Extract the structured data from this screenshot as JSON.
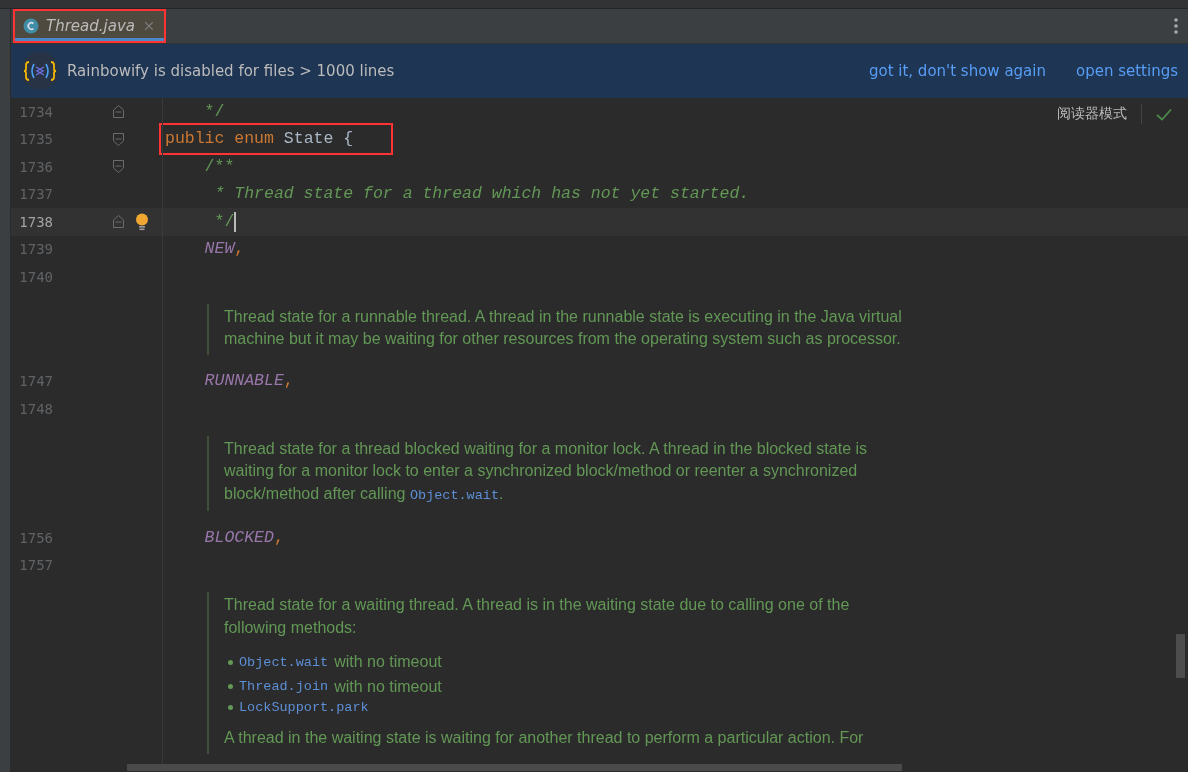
{
  "tabs": [
    {
      "label": "Thread.java",
      "selected": true,
      "highlighted": true
    }
  ],
  "banner": {
    "message": "Rainbowify is disabled for files > 1000 lines",
    "actions": [
      "got it, don't show again",
      "open settings"
    ]
  },
  "reader_mode": {
    "label": "阅读器模式"
  },
  "editor": {
    "lines": [
      {
        "kind": "code",
        "number": "1734",
        "current": false,
        "fold_close": true,
        "tokens": [
          {
            "text": "    */",
            "kind": "comment"
          }
        ]
      },
      {
        "kind": "code",
        "number": "1735",
        "current": false,
        "fold_open": true,
        "highlighted": true,
        "tokens": [
          {
            "text": "public ",
            "kind": "keyword"
          },
          {
            "text": "enum ",
            "kind": "keyword"
          },
          {
            "text": "State {",
            "kind": "plain"
          }
        ]
      },
      {
        "kind": "code",
        "number": "1736",
        "current": false,
        "fold_open": true,
        "tokens": [
          {
            "text": "    /**",
            "kind": "comment"
          }
        ]
      },
      {
        "kind": "code",
        "number": "1737",
        "current": false,
        "tokens": [
          {
            "text": "     * Thread state for a thread which has not yet started.",
            "kind": "doccomment"
          }
        ]
      },
      {
        "kind": "code",
        "number": "1738",
        "current": true,
        "fold_close": true,
        "bulb": true,
        "tokens": [
          {
            "text": "     */",
            "kind": "comment"
          }
        ]
      },
      {
        "kind": "code",
        "number": "1739",
        "current": false,
        "tokens": [
          {
            "text": "    NEW",
            "kind": "constant"
          },
          {
            "text": ",",
            "kind": "keyword"
          }
        ]
      },
      {
        "kind": "code",
        "number": "1740",
        "current": false
      },
      {
        "kind": "doc",
        "paragraphs": [
          [
            {
              "text": "Thread state for a runnable thread. A thread in the runnable state is executing in the Java virtual machine but it may be waiting for other resources from the operating system such as processor.",
              "kind": "text"
            }
          ]
        ]
      },
      {
        "kind": "code",
        "number": "1747",
        "current": false,
        "tokens": [
          {
            "text": "    RUNNABLE",
            "kind": "constant"
          },
          {
            "text": ",",
            "kind": "keyword"
          }
        ]
      },
      {
        "kind": "code",
        "number": "1748",
        "current": false
      },
      {
        "kind": "doc",
        "paragraphs": [
          [
            {
              "text": "Thread state for a thread blocked waiting for a monitor lock. A thread in the blocked state is waiting for a monitor lock to enter a synchronized block/method or reenter a synchronized block/method after calling ",
              "kind": "text"
            },
            {
              "text": "Object.wait",
              "kind": "code"
            },
            {
              "text": ".",
              "kind": "text"
            }
          ]
        ]
      },
      {
        "kind": "code",
        "number": "1756",
        "current": false,
        "tokens": [
          {
            "text": "    BLOCKED",
            "kind": "constant"
          },
          {
            "text": ",",
            "kind": "keyword"
          }
        ]
      },
      {
        "kind": "code",
        "number": "1757",
        "current": false
      },
      {
        "kind": "doc",
        "paragraphs": [
          [
            {
              "text": "Thread state for a waiting thread. A thread is in the waiting state due to calling one of the following methods:",
              "kind": "text"
            }
          ]
        ],
        "list": [
          {
            "code": "Object.wait",
            "text": "with no timeout"
          },
          {
            "code": "Thread.join",
            "text": "with no timeout"
          },
          {
            "code": "LockSupport.park"
          }
        ],
        "after": [
          [
            {
              "text": "A thread in the waiting state is waiting for another thread to perform a particular action. For",
              "kind": "text"
            }
          ]
        ]
      }
    ]
  }
}
